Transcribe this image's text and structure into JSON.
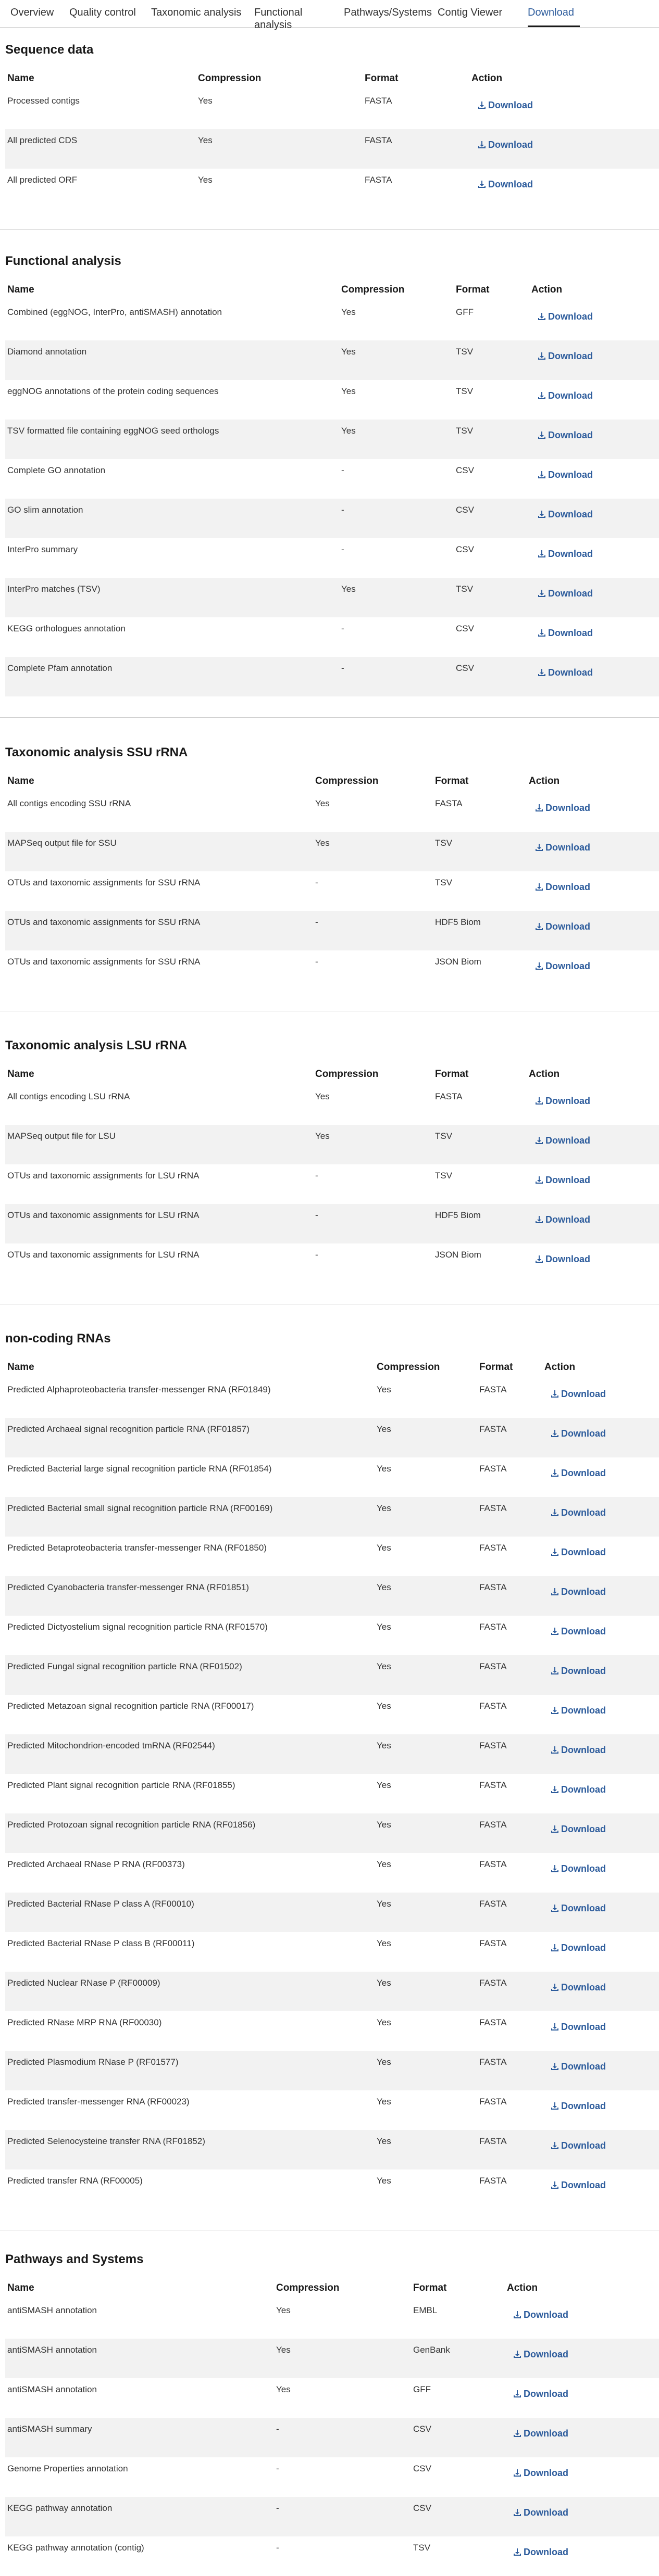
{
  "tabs": [
    "Overview",
    "Quality control",
    "Taxonomic analysis",
    "Functional analysis",
    "Pathways/Systems",
    "Contig Viewer",
    "Download"
  ],
  "active_tab": "Download",
  "columns": {
    "name": "Name",
    "compression": "Compression",
    "format": "Format",
    "action": "Action"
  },
  "download_label": "Download",
  "sections": [
    {
      "title": "Sequence data",
      "rows": [
        [
          "Processed contigs",
          "Yes",
          "FASTA"
        ],
        [
          "All predicted CDS",
          "Yes",
          "FASTA"
        ],
        [
          "All predicted ORF",
          "Yes",
          "FASTA"
        ]
      ]
    },
    {
      "title": "Functional analysis",
      "rows": [
        [
          "Combined (eggNOG, InterPro, antiSMASH) annotation",
          "Yes",
          "GFF"
        ],
        [
          "Diamond annotation",
          "Yes",
          "TSV"
        ],
        [
          "eggNOG annotations of the protein coding sequences",
          "Yes",
          "TSV"
        ],
        [
          "TSV formatted file containing eggNOG seed orthologs",
          "Yes",
          "TSV"
        ],
        [
          "Complete GO annotation",
          "-",
          "CSV"
        ],
        [
          "GO slim annotation",
          "-",
          "CSV"
        ],
        [
          "InterPro summary",
          "-",
          "CSV"
        ],
        [
          "InterPro matches (TSV)",
          "Yes",
          "TSV"
        ],
        [
          "KEGG orthologues annotation",
          "-",
          "CSV"
        ],
        [
          "Complete Pfam annotation",
          "-",
          "CSV"
        ]
      ]
    },
    {
      "title": "Taxonomic analysis SSU rRNA",
      "rows": [
        [
          "All contigs encoding SSU rRNA",
          "Yes",
          "FASTA"
        ],
        [
          "MAPSeq output file for SSU",
          "Yes",
          "TSV"
        ],
        [
          "OTUs and taxonomic assignments for SSU rRNA",
          "-",
          "TSV"
        ],
        [
          "OTUs and taxonomic assignments for SSU rRNA",
          "-",
          "HDF5 Biom"
        ],
        [
          "OTUs and taxonomic assignments for SSU rRNA",
          "-",
          "JSON Biom"
        ]
      ]
    },
    {
      "title": "Taxonomic analysis LSU rRNA",
      "rows": [
        [
          "All contigs encoding LSU rRNA",
          "Yes",
          "FASTA"
        ],
        [
          "MAPSeq output file for LSU",
          "Yes",
          "TSV"
        ],
        [
          "OTUs and taxonomic assignments for LSU rRNA",
          "-",
          "TSV"
        ],
        [
          "OTUs and taxonomic assignments for LSU rRNA",
          "-",
          "HDF5 Biom"
        ],
        [
          "OTUs and taxonomic assignments for LSU rRNA",
          "-",
          "JSON Biom"
        ]
      ]
    },
    {
      "title": "non-coding RNAs",
      "rows": [
        [
          "Predicted Alphaproteobacteria transfer-messenger RNA (RF01849)",
          "Yes",
          "FASTA"
        ],
        [
          "Predicted Archaeal signal recognition particle RNA (RF01857)",
          "Yes",
          "FASTA"
        ],
        [
          "Predicted Bacterial large signal recognition particle RNA (RF01854)",
          "Yes",
          "FASTA"
        ],
        [
          "Predicted Bacterial small signal recognition particle RNA (RF00169)",
          "Yes",
          "FASTA"
        ],
        [
          "Predicted Betaproteobacteria transfer-messenger RNA (RF01850)",
          "Yes",
          "FASTA"
        ],
        [
          "Predicted Cyanobacteria transfer-messenger RNA (RF01851)",
          "Yes",
          "FASTA"
        ],
        [
          "Predicted Dictyostelium signal recognition particle RNA (RF01570)",
          "Yes",
          "FASTA"
        ],
        [
          "Predicted Fungal signal recognition particle RNA (RF01502)",
          "Yes",
          "FASTA"
        ],
        [
          "Predicted Metazoan signal recognition particle RNA (RF00017)",
          "Yes",
          "FASTA"
        ],
        [
          "Predicted Mitochondrion-encoded tmRNA (RF02544)",
          "Yes",
          "FASTA"
        ],
        [
          "Predicted Plant signal recognition particle RNA (RF01855)",
          "Yes",
          "FASTA"
        ],
        [
          "Predicted Protozoan signal recognition particle RNA (RF01856)",
          "Yes",
          "FASTA"
        ],
        [
          "Predicted Archaeal RNase P RNA (RF00373)",
          "Yes",
          "FASTA"
        ],
        [
          "Predicted Bacterial RNase P class A (RF00010)",
          "Yes",
          "FASTA"
        ],
        [
          "Predicted Bacterial RNase P class B (RF00011)",
          "Yes",
          "FASTA"
        ],
        [
          "Predicted Nuclear RNase P (RF00009)",
          "Yes",
          "FASTA"
        ],
        [
          "Predicted RNase MRP RNA (RF00030)",
          "Yes",
          "FASTA"
        ],
        [
          "Predicted Plasmodium RNase P (RF01577)",
          "Yes",
          "FASTA"
        ],
        [
          "Predicted transfer-messenger RNA (RF00023)",
          "Yes",
          "FASTA"
        ],
        [
          "Predicted Selenocysteine transfer RNA (RF01852)",
          "Yes",
          "FASTA"
        ],
        [
          "Predicted transfer RNA (RF00005)",
          "Yes",
          "FASTA"
        ]
      ]
    },
    {
      "title": "Pathways and Systems",
      "rows": [
        [
          "antiSMASH annotation",
          "Yes",
          "EMBL"
        ],
        [
          "antiSMASH annotation",
          "Yes",
          "GenBank"
        ],
        [
          "antiSMASH annotation",
          "Yes",
          "GFF"
        ],
        [
          "antiSMASH summary",
          "-",
          "CSV"
        ],
        [
          "Genome Properties annotation",
          "-",
          "CSV"
        ],
        [
          "KEGG pathway annotation",
          "-",
          "CSV"
        ],
        [
          "KEGG pathway annotation (contig)",
          "-",
          "TSV"
        ]
      ]
    }
  ],
  "colors": {
    "link": "#2d5c9c",
    "stripe": "#f2f2f2",
    "header_text": "#1a1a1a"
  }
}
